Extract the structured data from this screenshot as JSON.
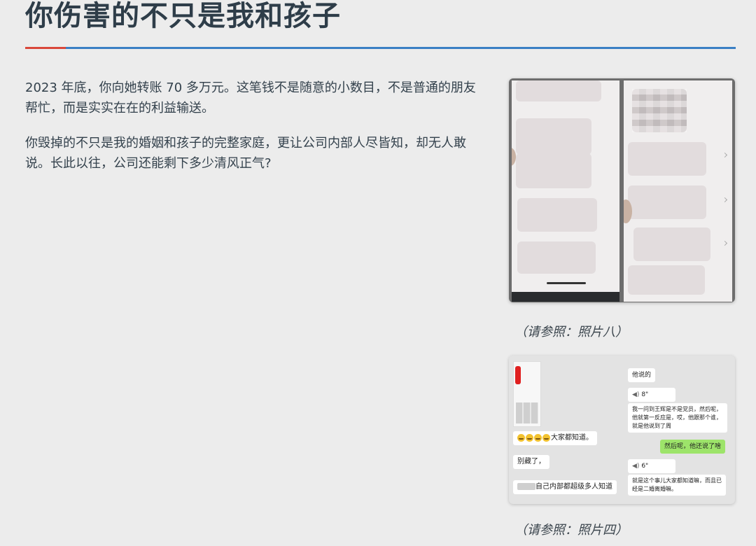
{
  "article": {
    "title": "你伤害的不只是我和孩子",
    "paragraphs": [
      "2023 年底，你向她转账 70 多万元。这笔钱不是随意的小数目，不是普通的朋友帮忙，而是实实在在的利益输送。",
      "你毁掉的不只是我的婚姻和孩子的完整家庭，更让公司内部人尽皆知，却无人敢说。长此以往，公司还能剩下多少清风正气?"
    ]
  },
  "figures": [
    {
      "caption": "（请参照：照片八）"
    },
    {
      "caption": "（请参照：照片四）"
    }
  ],
  "chat": {
    "messages": [
      {
        "text": "他说的",
        "side": "left"
      },
      {
        "text": "8\"",
        "side": "left",
        "type": "voice"
      },
      {
        "text": "我一问到王辉是不是党员，然后呢，他就第一反应是，哎，他跟那个谁，就是他说到了周",
        "side": "left"
      },
      {
        "text": "然后呢，他还说了啥",
        "side": "right"
      },
      {
        "text": "6\"",
        "side": "left",
        "type": "voice"
      },
      {
        "text": "就是这个事儿大家都知道嘛，而且已经是二婚离婚嘛。",
        "side": "left"
      },
      {
        "text": "大家都知道。",
        "side": "left"
      },
      {
        "text": "别藏了，",
        "side": "left"
      },
      {
        "text": "自己内部都超级多人知道",
        "side": "left"
      }
    ],
    "colors": {
      "green_bubble": "#9de46a",
      "bubble": "#ffffff"
    }
  },
  "accent_colors": {
    "rule": "#3a7fc4",
    "rule_accent": "#d9473a",
    "title": "#2e3d49"
  }
}
